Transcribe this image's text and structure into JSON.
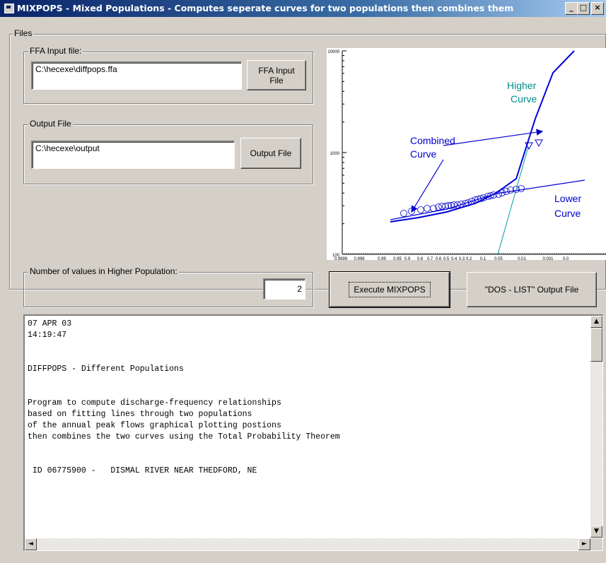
{
  "window": {
    "title": "MIXPOPS - Mixed Populations - Computes seperate curves for two populations then combines them",
    "minimize_label": "_",
    "maximize_label": "□",
    "close_label": "×"
  },
  "files_group": {
    "label": "Files"
  },
  "ffa_group": {
    "label": "FFA Input file:",
    "value": "C:\\hecexe\\diffpops.ffa",
    "button_line1": "FFA Input",
    "button_line2": "File"
  },
  "output_group": {
    "label": "Output File",
    "value": "C:\\hecexe\\output",
    "button_label": "Output File"
  },
  "higher_pop_group": {
    "label": "Number of values in Higher Population:",
    "value": "2"
  },
  "buttons": {
    "execute": "Execute MIXPOPS",
    "dos_list": "\"DOS - LIST\" Output File"
  },
  "chart_data": {
    "type": "line",
    "yscale": "log",
    "ylim": [
      100,
      10000
    ],
    "y_tick_labels": [
      "10000",
      "1000",
      "100"
    ],
    "x_tick_labels": [
      "0.9999",
      "0.999",
      "0.99",
      "0.95",
      "0.9",
      "0.8",
      "0.7",
      "0.6",
      "0.5",
      "0.4",
      "0.3",
      "0.2",
      "0.1",
      "0.05",
      "0.01",
      "0.001",
      "0.0"
    ],
    "annotations": [
      {
        "text_line1": "Higher",
        "text_line2": "Curve",
        "color": "#008b8b"
      },
      {
        "text_line1": "Combined",
        "text_line2": "Curve",
        "color": "#0000cc"
      },
      {
        "text_line1": "Lower",
        "text_line2": "Curve",
        "color": "#0000cc"
      }
    ],
    "colors": {
      "combined": "#0000dd",
      "higher": "#00a0a0",
      "points": "#0000cc"
    }
  },
  "output_text": {
    "lines": [
      "07 APR 03",
      "14:19:47",
      "",
      "",
      "DIFFPOPS - Different Populations",
      "",
      "",
      "Program to compute discharge-frequency relationships",
      "based on fitting lines through two populations",
      "of the annual peak flows graphical plotting postions",
      "then combines the two curves using the Total Probability Theorem",
      "",
      "",
      " ID 06775900 -   DISMAL RIVER NEAR THEDFORD, NE"
    ]
  },
  "scroll": {
    "up": "▲",
    "down": "▼",
    "left": "◄",
    "right": "►"
  }
}
